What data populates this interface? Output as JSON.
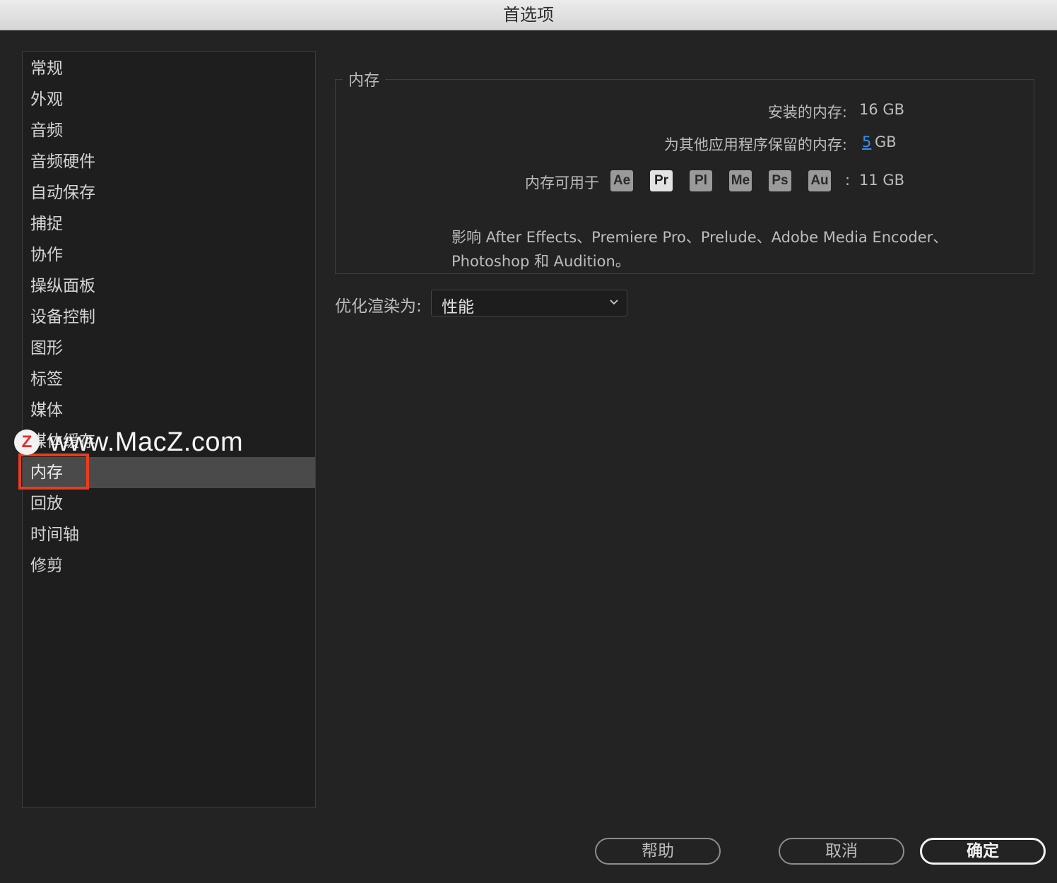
{
  "window": {
    "title": "首选项"
  },
  "sidebar": {
    "items": [
      {
        "label": "常规"
      },
      {
        "label": "外观"
      },
      {
        "label": "音频"
      },
      {
        "label": "音频硬件"
      },
      {
        "label": "自动保存"
      },
      {
        "label": "捕捉"
      },
      {
        "label": "协作"
      },
      {
        "label": "操纵面板"
      },
      {
        "label": "设备控制"
      },
      {
        "label": "图形"
      },
      {
        "label": "标签"
      },
      {
        "label": "媒体"
      },
      {
        "label": "媒体缓存"
      },
      {
        "label": "内存",
        "selected": true
      },
      {
        "label": "回放"
      },
      {
        "label": "时间轴"
      },
      {
        "label": "修剪"
      }
    ],
    "highlight_color": "#e63d20"
  },
  "watermark": {
    "logo": "Z",
    "text": "www.MacZ.com"
  },
  "memory": {
    "group_title": "内存",
    "installed_label": "安装的内存:",
    "installed_value": "16 GB",
    "reserved_label": "为其他应用程序保留的内存:",
    "reserved_value": "5",
    "reserved_unit": "GB",
    "available_label": "内存可用于",
    "apps": [
      {
        "abbr": "Ae",
        "active": false
      },
      {
        "abbr": "Pr",
        "active": true
      },
      {
        "abbr": "Pl",
        "active": false
      },
      {
        "abbr": "Me",
        "active": false
      },
      {
        "abbr": "Ps",
        "active": false
      },
      {
        "abbr": "Au",
        "active": false
      }
    ],
    "available_colon": ":",
    "available_value": "11 GB",
    "description_line1": "影响 After Effects、Premiere Pro、Prelude、Adobe Media Encoder、",
    "description_line2": "Photoshop 和 Audition。"
  },
  "render": {
    "label": "优化渲染为:",
    "selected": "性能"
  },
  "buttons": {
    "help": "帮助",
    "cancel": "取消",
    "ok": "确定"
  },
  "colors": {
    "background": "#232323",
    "link": "#3a8ee6"
  }
}
